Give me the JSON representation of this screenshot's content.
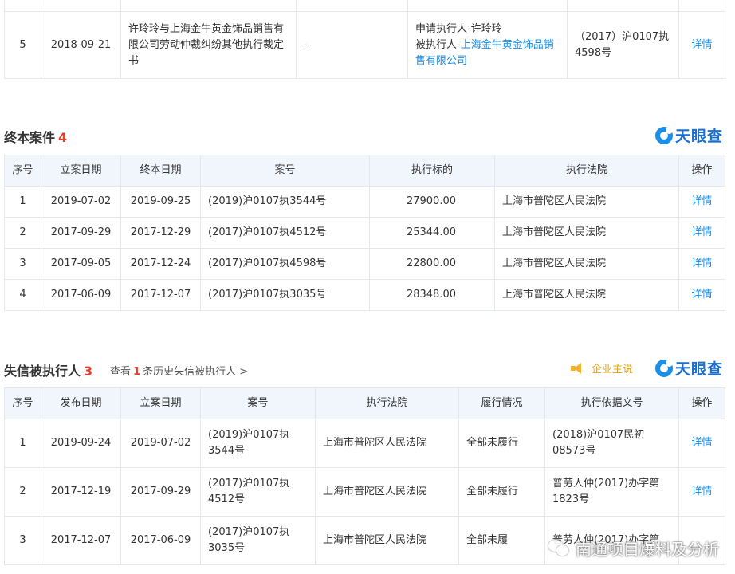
{
  "section1": {
    "row": {
      "index": "5",
      "date": "2018-09-21",
      "title": "许玲玲与上海金牛黄金饰品销售有限公司劳动仲裁纠纷其他执行裁定书",
      "dash": "-",
      "party_applicant": "申请执行人-许玲玲",
      "party_respondent_prefix": "被执行人-",
      "party_respondent_link": "上海金牛黄金饰品销售有限公司",
      "case_no": "（2017）沪0107执4598号",
      "detail": "详情"
    }
  },
  "section2": {
    "title": "终本案件",
    "count": "4",
    "logo": "天眼查",
    "headers": [
      "序号",
      "立案日期",
      "终本日期",
      "案号",
      "执行标的",
      "执行法院",
      "操作"
    ],
    "rows": [
      {
        "index": "1",
        "filing_date": "2019-07-02",
        "end_date": "2019-09-25",
        "case_no": "(2019)沪0107执3544号",
        "amount": "27900.00",
        "court": "上海市普陀区人民法院",
        "detail": "详情"
      },
      {
        "index": "2",
        "filing_date": "2017-09-29",
        "end_date": "2017-12-29",
        "case_no": "(2017)沪0107执4512号",
        "amount": "25344.00",
        "court": "上海市普陀区人民法院",
        "detail": "详情"
      },
      {
        "index": "3",
        "filing_date": "2017-09-05",
        "end_date": "2017-12-24",
        "case_no": "(2017)沪0107执4598号",
        "amount": "22800.00",
        "court": "上海市普陀区人民法院",
        "detail": "详情"
      },
      {
        "index": "4",
        "filing_date": "2017-06-09",
        "end_date": "2017-12-07",
        "case_no": "(2017)沪0107执3035号",
        "amount": "28348.00",
        "court": "上海市普陀区人民法院",
        "detail": "详情"
      }
    ]
  },
  "section3": {
    "title": "失信被执行人",
    "count": "3",
    "history_prefix": "查看",
    "history_count": "1",
    "history_suffix": "条历史失信被执行人 >",
    "vip_label": "企业主说",
    "logo": "天眼查",
    "headers": [
      "序号",
      "发布日期",
      "立案日期",
      "案号",
      "执行法院",
      "履行情况",
      "执行依据文号",
      "操作"
    ],
    "rows": [
      {
        "index": "1",
        "publish_date": "2019-09-24",
        "filing_date": "2019-07-02",
        "case_no_1": "(2019)沪0107执",
        "case_no_2": "3544号",
        "court": "上海市普陀区人民法院",
        "status": "全部未履行",
        "basis_1": "(2018)沪0107民初",
        "basis_2": "08573号",
        "detail": "详情"
      },
      {
        "index": "2",
        "publish_date": "2017-12-19",
        "filing_date": "2017-09-29",
        "case_no_1": "(2017)沪0107执",
        "case_no_2": "4512号",
        "court": "上海市普陀区人民法院",
        "status": "全部未履行",
        "basis_1": "普劳人仲(2017)办字第",
        "basis_2": "1823号",
        "detail": "详情"
      },
      {
        "index": "3",
        "publish_date": "2017-12-07",
        "filing_date": "2017-06-09",
        "case_no_1": "(2017)沪0107执",
        "case_no_2": "3035号",
        "court": "上海市普陀区人民法院",
        "status": "全部未履",
        "basis_1": "普劳人仲(2017)办字第",
        "basis_2": "",
        "detail": ""
      }
    ]
  },
  "watermark": "南通项目爆料及分析"
}
